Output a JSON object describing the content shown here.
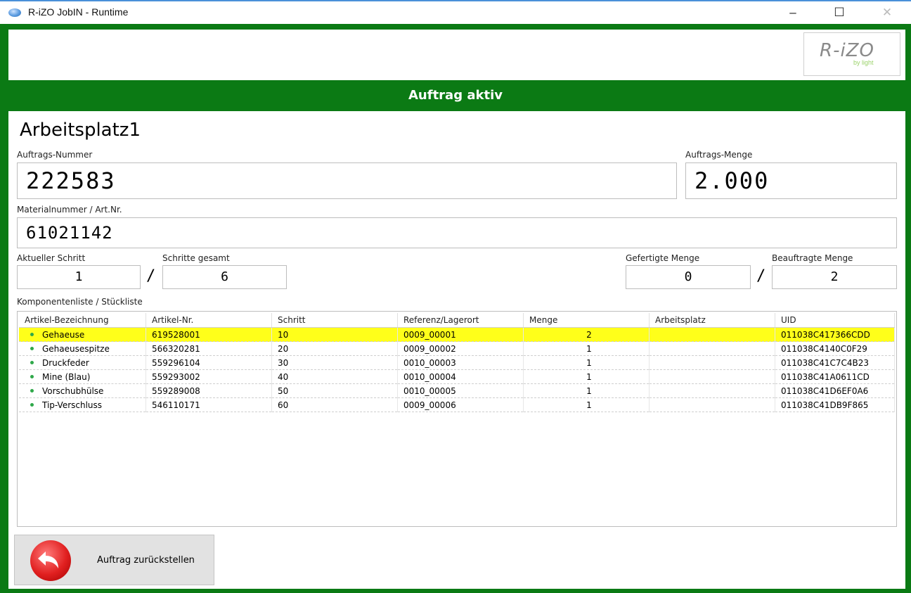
{
  "window": {
    "title": "R-iZO JobIN - Runtime",
    "minimize": "–",
    "maximize": "☐",
    "close": "✕"
  },
  "logo": {
    "main": "R-iZO",
    "sub": "by light"
  },
  "status": "Auftrag aktiv",
  "workplace": "Arbeitsplatz1",
  "order": {
    "number_label": "Auftrags-Nummer",
    "number": "222583",
    "qty_label": "Auftrags-Menge",
    "qty": "2.000",
    "material_label": "Materialnummer / Art.Nr.",
    "material": "61021142"
  },
  "steps": {
    "current_label": "Aktueller Schritt",
    "current": "1",
    "total_label": "Schritte gesamt",
    "total": "6",
    "done_label": "Gefertigte Menge",
    "done": "0",
    "ordered_label": "Beauftragte Menge",
    "ordered": "2",
    "slash": "/"
  },
  "components": {
    "label": "Komponentenliste / Stückliste",
    "columns": [
      "Artikel-Bezeichnung",
      "Artikel-Nr.",
      "Schritt",
      "Referenz/Lagerort",
      "Menge",
      "Arbeitsplatz",
      "UID"
    ],
    "rows": [
      [
        "Gehaeuse",
        "619528001",
        "10",
        "0009_00001",
        "2",
        "",
        "011038C417366CDD"
      ],
      [
        "Gehaeusespitze",
        "566320281",
        "20",
        "0009_00002",
        "1",
        "",
        "011038C4140C0F29"
      ],
      [
        "Druckfeder",
        "559296104",
        "30",
        "0010_00003",
        "1",
        "",
        "011038C41C7C4B23"
      ],
      [
        "Mine (Blau)",
        "559293002",
        "40",
        "0010_00004",
        "1",
        "",
        "011038C41A0611CD"
      ],
      [
        "Vorschubhülse",
        "559289008",
        "50",
        "0010_00005",
        "1",
        "",
        "011038C41D6EF0A6"
      ],
      [
        "Tip-Verschluss",
        "546110171",
        "60",
        "0009_00006",
        "1",
        "",
        "011038C41DB9F865"
      ]
    ],
    "selected_row": 0,
    "highlight_color": "#ffff1a"
  },
  "back_button": {
    "label": "Auftrag zurückstellen",
    "icon": "undo-arrow-icon"
  },
  "colors": {
    "frame": "#0b7a14",
    "back_button": "#e12020"
  }
}
